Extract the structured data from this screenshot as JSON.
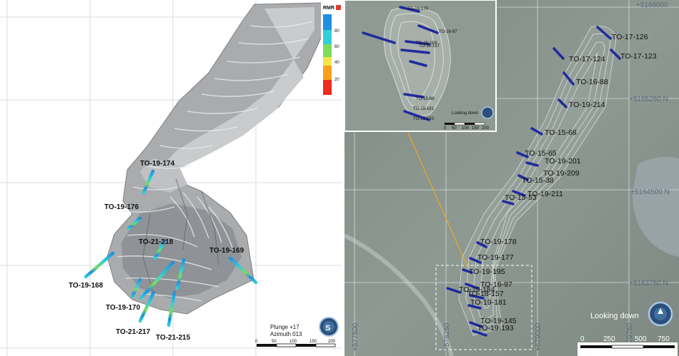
{
  "left_view": {
    "legend": {
      "title": "RMR",
      "ticks": [
        "80",
        "60",
        "40",
        "20"
      ],
      "colors": [
        "#1e90e0",
        "#2fd0d8",
        "#7ddc5a",
        "#f4e64a",
        "#f7a01e",
        "#ef2a1e"
      ]
    },
    "drillholes": [
      "TO-19-174",
      "TO-19-176",
      "TO-21-218",
      "TO-19-169",
      "TO-19-168",
      "TO-19-170",
      "TO-21-217",
      "TO-21-215"
    ],
    "orientation": {
      "plunge": "Plunge +17",
      "azimuth": "Azimuth 013"
    },
    "scale_bar": [
      "0",
      "50",
      "100",
      "150",
      "200"
    ],
    "compass_letter": "S"
  },
  "right_view": {
    "coord_labels": [
      "+5166000",
      "+5165250 N",
      "+5164500 N",
      "+5163750 N",
      "+577500",
      "+578250",
      "+579000",
      "+579750"
    ],
    "drillholes": [
      "TO-17-126",
      "TO-17-124",
      "TO-17-123",
      "TO-16-88",
      "TO-19-214",
      "TO-15-68",
      "TO-15-65",
      "TO-19-201",
      "TO-19-209",
      "TO-15-38",
      "TO-19-211",
      "TO-15-53",
      "TO-19-178",
      "TO-19-177",
      "TO-19-195",
      "TO-16-97",
      "TO-19-184",
      "TO-18-157",
      "TO-19-181",
      "TO-19-145",
      "TO-19-193"
    ],
    "view_label": "Looking down",
    "scale_bar": [
      "0",
      "250",
      "500",
      "750"
    ],
    "inset": {
      "view_label": "Looking down",
      "scale_bar": [
        "0",
        "50",
        "100",
        "150",
        "200"
      ],
      "drillholes": [
        "TO-19-170",
        "TO-16-97",
        "TO-18-157",
        "TO-19-169",
        "TO-15-68",
        "TO-19-181",
        "TO-19-193"
      ]
    }
  }
}
